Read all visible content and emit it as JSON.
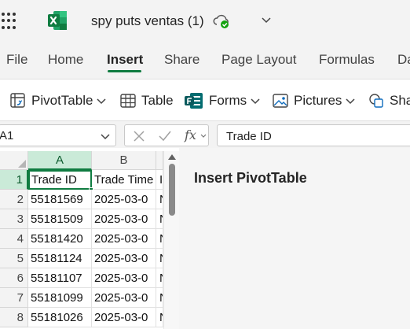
{
  "title_bar": {
    "doc_title": "spy puts ventas (1)"
  },
  "tabs": [
    "File",
    "Home",
    "Insert",
    "Share",
    "Page Layout",
    "Formulas",
    "Da"
  ],
  "ribbon": {
    "pivottable": "PivotTable",
    "table": "Table",
    "forms": "Forms",
    "pictures": "Pictures",
    "shapes": "Sha"
  },
  "formula_bar": {
    "name_box": "A1",
    "fx": "fx",
    "content": "Trade ID"
  },
  "grid": {
    "columns": [
      "A",
      "B"
    ],
    "rows": [
      {
        "num": "1",
        "a": "Trade ID",
        "b": "Trade Time",
        "c": "Is"
      },
      {
        "num": "2",
        "a": "55181569",
        "b": "2025-03-0",
        "c": "N"
      },
      {
        "num": "3",
        "a": "55181509",
        "b": "2025-03-0",
        "c": "N"
      },
      {
        "num": "4",
        "a": "55181420",
        "b": "2025-03-0",
        "c": "N"
      },
      {
        "num": "5",
        "a": "55181124",
        "b": "2025-03-0",
        "c": "N"
      },
      {
        "num": "6",
        "a": "55181107",
        "b": "2025-03-0",
        "c": "N"
      },
      {
        "num": "7",
        "a": "55181099",
        "b": "2025-03-0",
        "c": "N"
      },
      {
        "num": "8",
        "a": "55181026",
        "b": "2025-03-0",
        "c": "N"
      }
    ]
  },
  "pane": {
    "title": "Insert PivotTable"
  },
  "colors": {
    "accent": "#107c41",
    "selected_header": "#caead8"
  }
}
